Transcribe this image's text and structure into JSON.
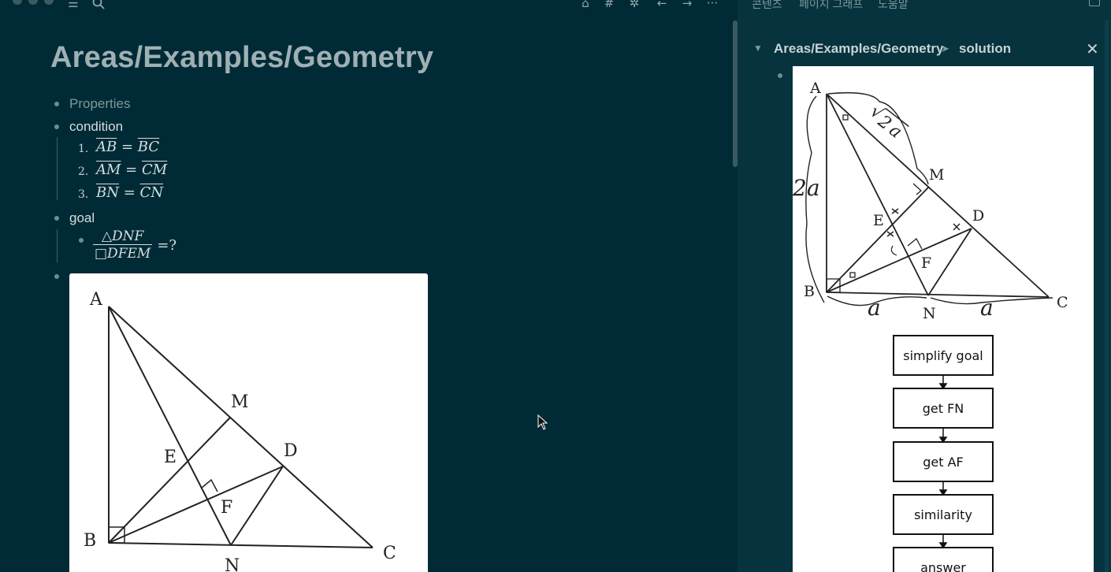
{
  "toolbar": {
    "left_icons": [
      "menu-icon",
      "search-icon"
    ],
    "right_icons": [
      "home-icon",
      "tag-icon",
      "puzzle-icon",
      "back-icon",
      "forward-icon",
      "more-icon"
    ]
  },
  "main": {
    "title": "Areas/Examples/Geometry",
    "blocks": {
      "properties": "Properties",
      "condition": "condition",
      "goal": "goal"
    },
    "conditions": [
      {
        "num": "1.",
        "left": "AB",
        "eq": "=",
        "right": "BC"
      },
      {
        "num": "2.",
        "left": "AM",
        "eq": "=",
        "right": "CM"
      },
      {
        "num": "3.",
        "left": "BN",
        "eq": "=",
        "right": "CN"
      }
    ],
    "goal_expr": {
      "numerator": "△DNF",
      "denominator": "□DFEM",
      "equals": "=?"
    },
    "figure_labels": {
      "A": "A",
      "B": "B",
      "C": "C",
      "D": "D",
      "E": "E",
      "F": "F",
      "M": "M",
      "N": "N"
    }
  },
  "right_panel": {
    "tabs": [
      "콘텐츠",
      "페이지 그래프",
      "도움말"
    ],
    "breadcrumb_path": "Areas/Examples/Geometry",
    "breadcrumb_sep": "➤",
    "breadcrumb_page": "solution",
    "close_label": "✕",
    "collapse_label": "▼",
    "figure_labels": {
      "A": "A",
      "B": "B",
      "C": "C",
      "D": "D",
      "E": "E",
      "F": "F",
      "M": "M",
      "N": "N",
      "side_2a": "2a",
      "side_a1": "a",
      "side_a2": "a",
      "sqrt": "√",
      "sqrt_arg": "2",
      "sqrt_a": "a"
    },
    "flow_steps": [
      "simplify goal",
      "get FN",
      "get AF",
      "similarity",
      "answer"
    ]
  }
}
